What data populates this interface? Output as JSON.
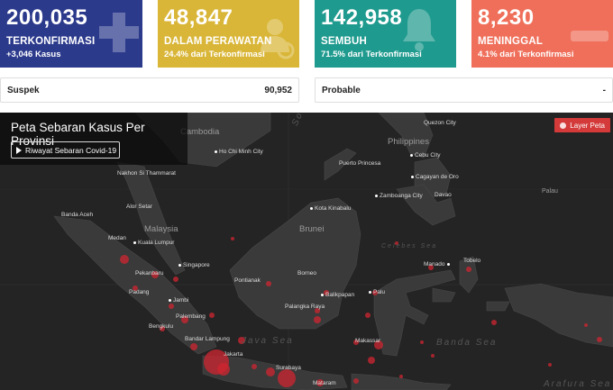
{
  "stats": [
    {
      "value": "200,035",
      "label": "TERKONFIRMASI",
      "sub": "+3,046 Kasus",
      "color": "#2c3a8c"
    },
    {
      "value": "48,847",
      "label": "DALAM PERAWATAN",
      "sub": "24.4% dari Terkonfirmasi",
      "color": "#d9b638"
    },
    {
      "value": "142,958",
      "label": "SEMBUH",
      "sub": "71.5% dari Terkonfirmasi",
      "color": "#1f9a8e"
    },
    {
      "value": "8,230",
      "label": "MENINGGAL",
      "sub": "4.1% dari Terkonfirmasi",
      "color": "#ef6f5a"
    }
  ],
  "suspek": {
    "label": "Suspek",
    "value": "90,952"
  },
  "probable": {
    "label": "Probable",
    "value": "-"
  },
  "map": {
    "title": "Peta Sebaran Kasus Per Provinsi",
    "history_button": "Riwayat Sebaran Covid-19",
    "layer_button": "Layer Peta",
    "countries": [
      "Cambodia",
      "Philippines",
      "Malaysia",
      "Brunei",
      "Palau"
    ],
    "regions": [
      "South China Sea",
      "Java Sea",
      "Banda Sea",
      "Celebes Sea",
      "Arafura Sea"
    ],
    "cities": [
      "Ho Chi Minh City",
      "Nakhon Si Thammarat",
      "Banda Aceh",
      "Alor Setar",
      "Medan",
      "Kuala Lumpur",
      "Pekanbaru",
      "Singapore",
      "Padang",
      "Jambi",
      "Palembang",
      "Bengkulu",
      "Bandar Lampung",
      "Jakarta",
      "Surabaya",
      "Mataram",
      "Pontianak",
      "Kota Kinabalu",
      "Borneo",
      "Balikpapan",
      "Palangka Raya",
      "Makassar",
      "Palu",
      "Manado",
      "Tobelo",
      "Puerto Princesa",
      "Cebu City",
      "Cagayan de Oro",
      "Zamboanga City",
      "Davao",
      "Quezon City"
    ]
  }
}
